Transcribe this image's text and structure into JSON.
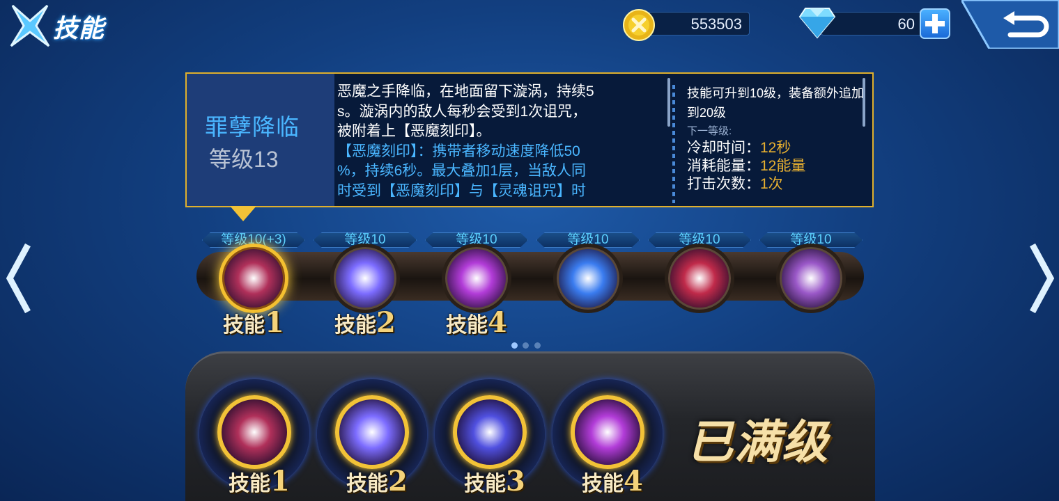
{
  "header": {
    "title": "技能",
    "coins": "553503",
    "gems": "60"
  },
  "info": {
    "skill_name": "罪孽降临",
    "skill_level": "等级13",
    "desc_lines": [
      "恶魔之手降临，在地面留下漩涡，持续5",
      "s。漩涡内的敌人每秒会受到1次诅咒，",
      "被附着上【恶魔刻印】。",
      "【恶魔刻印】：携带者移动速度降低50",
      "%，持续6秒。最大叠加1层，当敌人同",
      "时受到【恶魔刻印】与【灵魂诅咒】时"
    ],
    "side_top": "技能可升到10级，装备额外追加到20级",
    "next_level_label": "下一等级:",
    "stats": [
      {
        "label": "冷却时间：",
        "value": "12秒"
      },
      {
        "label": "消耗能量：",
        "value": "12能量"
      },
      {
        "label": "打击次数：",
        "value": "1次"
      }
    ]
  },
  "skills": [
    {
      "level": "等级10(+3)",
      "slot_prefix": "技能",
      "slot_num": "1",
      "icon": "demon-claw-icon",
      "color": "#b0305a"
    },
    {
      "level": "等级10",
      "slot_prefix": "技能",
      "slot_num": "2",
      "icon": "light-burst-icon",
      "color": "#7c6cff"
    },
    {
      "level": "等级10",
      "slot_prefix": "技能",
      "slot_num": "4",
      "icon": "purple-vortex-icon",
      "color": "#b23cd8"
    },
    {
      "level": "等级10",
      "slot_prefix": "",
      "slot_num": "",
      "icon": "blue-whirlwind-icon",
      "color": "#3a7cf0"
    },
    {
      "level": "等级10",
      "slot_prefix": "",
      "slot_num": "",
      "icon": "crimson-slash-icon",
      "color": "#c02a4a"
    },
    {
      "level": "等级10",
      "slot_prefix": "",
      "slot_num": "",
      "icon": "phantom-wing-icon",
      "color": "#9a58c8"
    }
  ],
  "pager": {
    "count": 3,
    "active": 0
  },
  "equipped": [
    {
      "prefix": "技能",
      "num": "1",
      "icon": "demon-claw-icon",
      "color": "#b0305a"
    },
    {
      "prefix": "技能",
      "num": "2",
      "icon": "light-burst-icon",
      "color": "#7c6cff"
    },
    {
      "prefix": "技能",
      "num": "3",
      "icon": "eye-rune-icon",
      "color": "#5050e0"
    },
    {
      "prefix": "技能",
      "num": "4",
      "icon": "purple-vortex-icon",
      "color": "#b23cd8"
    }
  ],
  "status": "已满级"
}
